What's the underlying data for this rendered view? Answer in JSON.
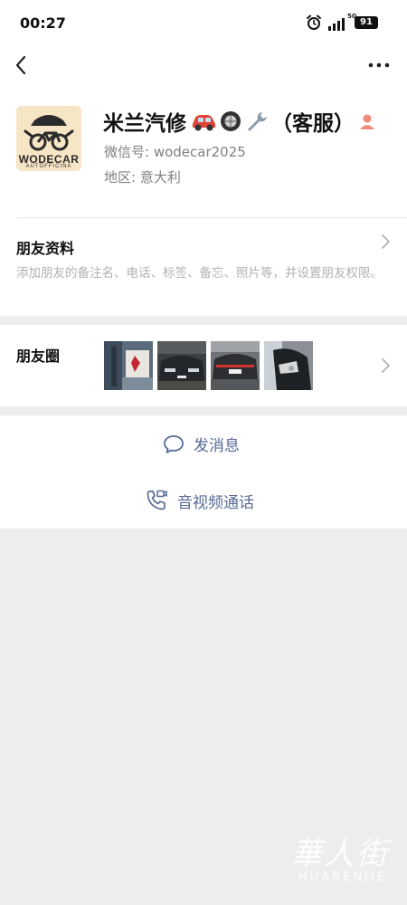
{
  "status_bar": {
    "time": "00:27",
    "network": "5G",
    "battery": "91"
  },
  "nav": {
    "back_icon": "chevron-left-icon",
    "more_icon": "more-dots-icon"
  },
  "profile": {
    "avatar_title": "WODECAR",
    "avatar_subtitle": "AUTOFFICINA",
    "nickname": "米兰汽修",
    "nickname_suffix": "（客服）",
    "nickname_emojis": [
      "car-emoji",
      "wheel-emoji",
      "wrench-emoji"
    ],
    "gender_icon": "person-badge-icon",
    "wechat_id": "微信号: wodecar2025",
    "region": "地区: 意大利"
  },
  "friend_info": {
    "title": "朋友资料",
    "description": "添加朋友的备注名、电话、标签、备忘、照片等，并设置朋友权限。"
  },
  "moments": {
    "title": "朋友圈",
    "thumbnail_count": 4
  },
  "actions": {
    "message": {
      "label": "发消息",
      "icon": "chat-bubble-icon"
    },
    "call": {
      "label": "音视频通话",
      "icon": "phone-video-icon"
    }
  },
  "watermark": {
    "main": "華人街",
    "sub": "HUARENJIE"
  },
  "colors": {
    "link_blue": "#576b95",
    "page_gray": "#ededed",
    "secondary_text": "#808080",
    "hint_text": "#b2b2b2"
  }
}
